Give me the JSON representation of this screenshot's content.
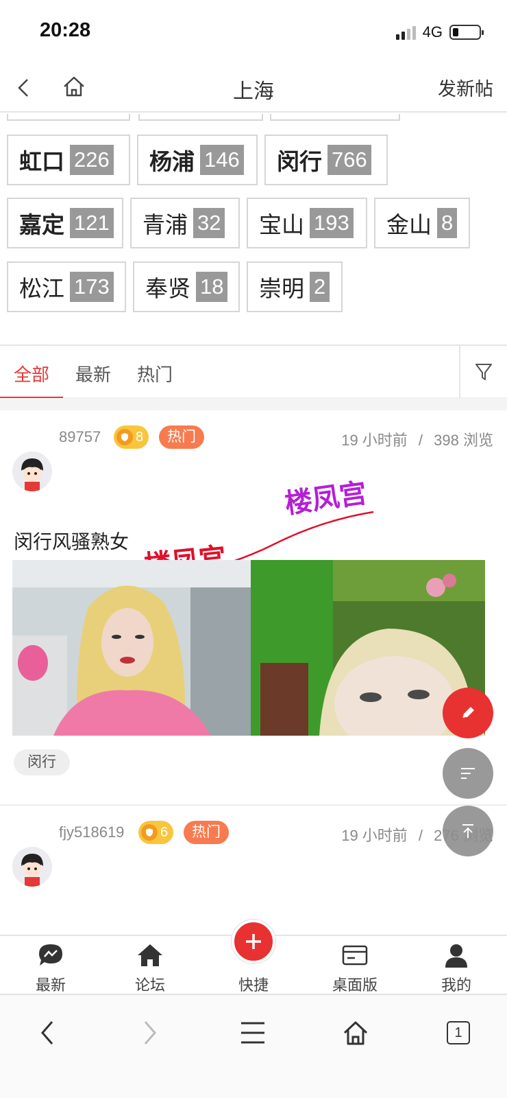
{
  "status_bar": {
    "time": "20:28",
    "network": "4G",
    "battery_level": 0.2
  },
  "nav": {
    "title": "上海",
    "new_post_label": "发新帖"
  },
  "districts": [
    {
      "name": "虹口",
      "count": "226",
      "bold": true
    },
    {
      "name": "杨浦",
      "count": "146",
      "bold": true
    },
    {
      "name": "闵行",
      "count": "766",
      "bold": true
    },
    {
      "name": "嘉定",
      "count": "121",
      "bold": true
    },
    {
      "name": "青浦",
      "count": "32",
      "bold": false
    },
    {
      "name": "宝山",
      "count": "193",
      "bold": false
    },
    {
      "name": "金山",
      "count": "8",
      "bold": false
    },
    {
      "name": "松江",
      "count": "173",
      "bold": false
    },
    {
      "name": "奉贤",
      "count": "18",
      "bold": false
    },
    {
      "name": "崇明",
      "count": "2",
      "bold": false
    }
  ],
  "tabs": {
    "all": "全部",
    "latest": "最新",
    "hot": "热门",
    "active": "all"
  },
  "posts": [
    {
      "user": "89757",
      "level": "8",
      "hot_label": "热门",
      "time": "19 小时前",
      "separator": "/",
      "views": "398 浏览",
      "title": "闵行风骚熟女",
      "watermark": "楼凤宫",
      "tag": "闵行"
    },
    {
      "user": "fjy518619",
      "level": "6",
      "hot_label": "热门",
      "time": "19 小时前",
      "separator": "/",
      "views": "276 浏览"
    }
  ],
  "bottom_tabs": [
    {
      "label": "最新",
      "icon": "chat-bubble-icon"
    },
    {
      "label": "论坛",
      "icon": "home-icon"
    },
    {
      "label": "快捷",
      "icon": "plus-icon"
    },
    {
      "label": "桌面版",
      "icon": "desktop-card-icon"
    },
    {
      "label": "我的",
      "icon": "user-icon"
    }
  ],
  "browser": {
    "tabs_count": "1"
  },
  "colors": {
    "accent": "#e53935",
    "badge_gray": "#999999",
    "hot": "#f77b4f",
    "level": "#f8c53c"
  }
}
